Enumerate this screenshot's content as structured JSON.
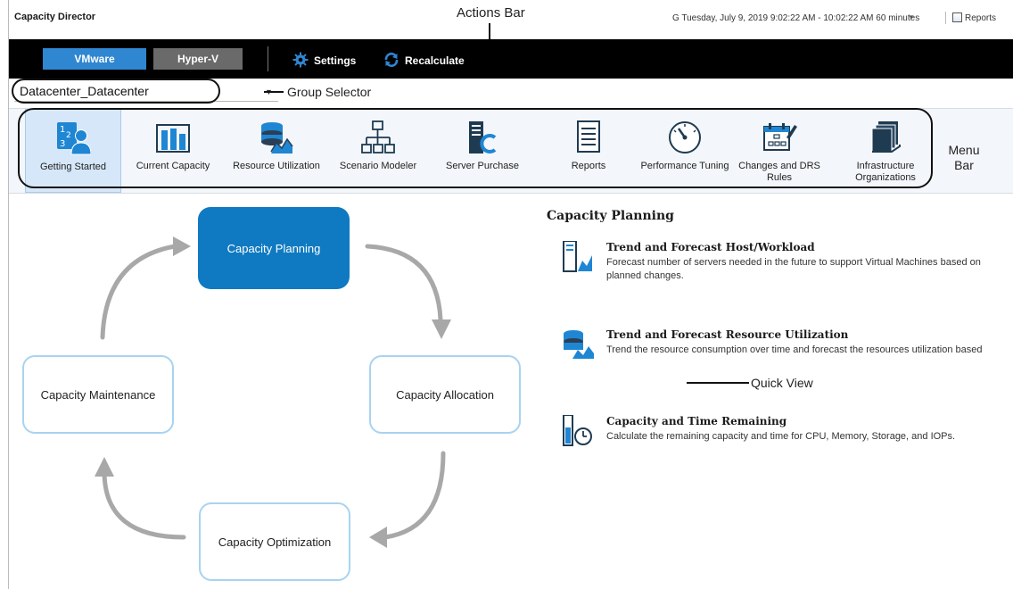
{
  "app": {
    "title": "Capacity Director"
  },
  "header": {
    "timerange": "G Tuesday, July 9, 2019 9:02:22 AM - 10:02:22 AM 60 minutes",
    "reports_label": "Reports"
  },
  "annotations": {
    "actions_bar": "Actions Bar",
    "group_selector": "Group Selector",
    "menu_bar_line1": "Menu",
    "menu_bar_line2": "Bar",
    "quick_view": "Quick View"
  },
  "actionbar": {
    "tabs": [
      {
        "label": "VMware"
      },
      {
        "label": "Hyper-V"
      }
    ],
    "settings_label": "Settings",
    "recalculate_label": "Recalculate"
  },
  "group_selector": {
    "value": "Datacenter_Datacenter"
  },
  "menu": {
    "items": [
      {
        "label": "Getting Started",
        "icon": "getting-started-icon"
      },
      {
        "label": "Current Capacity",
        "icon": "bar-chart-icon"
      },
      {
        "label": "Resource Utilization",
        "icon": "database-chart-icon"
      },
      {
        "label": "Scenario Modeler",
        "icon": "hierarchy-icon"
      },
      {
        "label": "Server Purchase",
        "icon": "server-icon"
      },
      {
        "label": "Reports",
        "icon": "document-icon"
      },
      {
        "label": "Performance Tuning",
        "icon": "gauge-icon"
      },
      {
        "label": "Changes and DRS Rules",
        "icon": "calendar-edit-icon"
      },
      {
        "label": "Infrastructure Organizations",
        "icon": "stack-icon"
      }
    ]
  },
  "cycle": {
    "planning": "Capacity Planning",
    "allocation": "Capacity Allocation",
    "optimization": "Capacity Optimization",
    "maintenance": "Capacity Maintenance"
  },
  "quick_view": {
    "heading": "Capacity Planning",
    "items": [
      {
        "title": "Trend and Forecast Host/Workload",
        "desc_line1": "Forecast number of servers needed in the future to support Virtual Machines based on",
        "desc_line2": "planned changes."
      },
      {
        "title": "Trend and Forecast Resource Utilization",
        "desc_line1": "Trend the resource consumption over time and forecast the resources utilization based"
      },
      {
        "title": "Capacity and Time Remaining",
        "desc_line1": "Calculate the remaining capacity and time for CPU, Memory, Storage, and IOPs."
      }
    ]
  },
  "colors": {
    "accent": "#0f7ac1",
    "vmware_tab": "#2f86d1",
    "hyperv_tab": "#6a6a6a",
    "node_border": "#a9d3f1",
    "arrow": "#a8a8a8"
  }
}
